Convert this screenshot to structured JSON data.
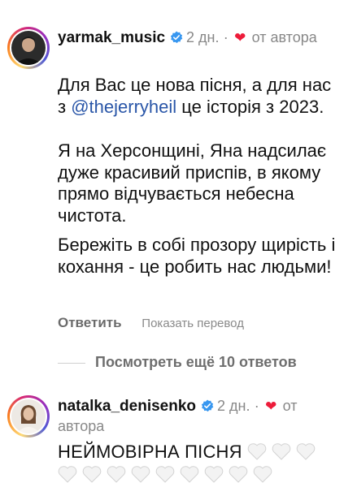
{
  "comments": [
    {
      "username": "yarmak_music",
      "time": "2 дн.",
      "separator": "·",
      "liked_by_author": "от автора",
      "paragraphs": {
        "p1_before": "Для Вас це нова пісня, а для нас з ",
        "p1_mention": "@thejerryheil",
        "p1_after": " це історія з 2023.",
        "p2": "Я на Херсонщині, Яна надсилає дуже красивий приспів, в якому прямо відчувається небесна чистота.",
        "p3": "Бережіть в собі прозору щирість і кохання - це робить нас людьми!"
      },
      "reply_label": "Ответить",
      "translate_label": "Показать перевод"
    },
    {
      "username": "natalka_denisenko",
      "time": "2 дн.",
      "separator": "·",
      "liked_by_author": "от автора",
      "text": "НЕЙМОВІРНА ПІСНЯ"
    }
  ],
  "view_more_replies": "Посмотреть ещё 10 ответов",
  "icons": {
    "verified": "verified-badge-icon",
    "heart": "heart-icon",
    "white_heart": "white-heart-emoji"
  },
  "colors": {
    "verified": "#3897f0",
    "heart": "#ed1c3a",
    "mention": "#2a56a8"
  }
}
